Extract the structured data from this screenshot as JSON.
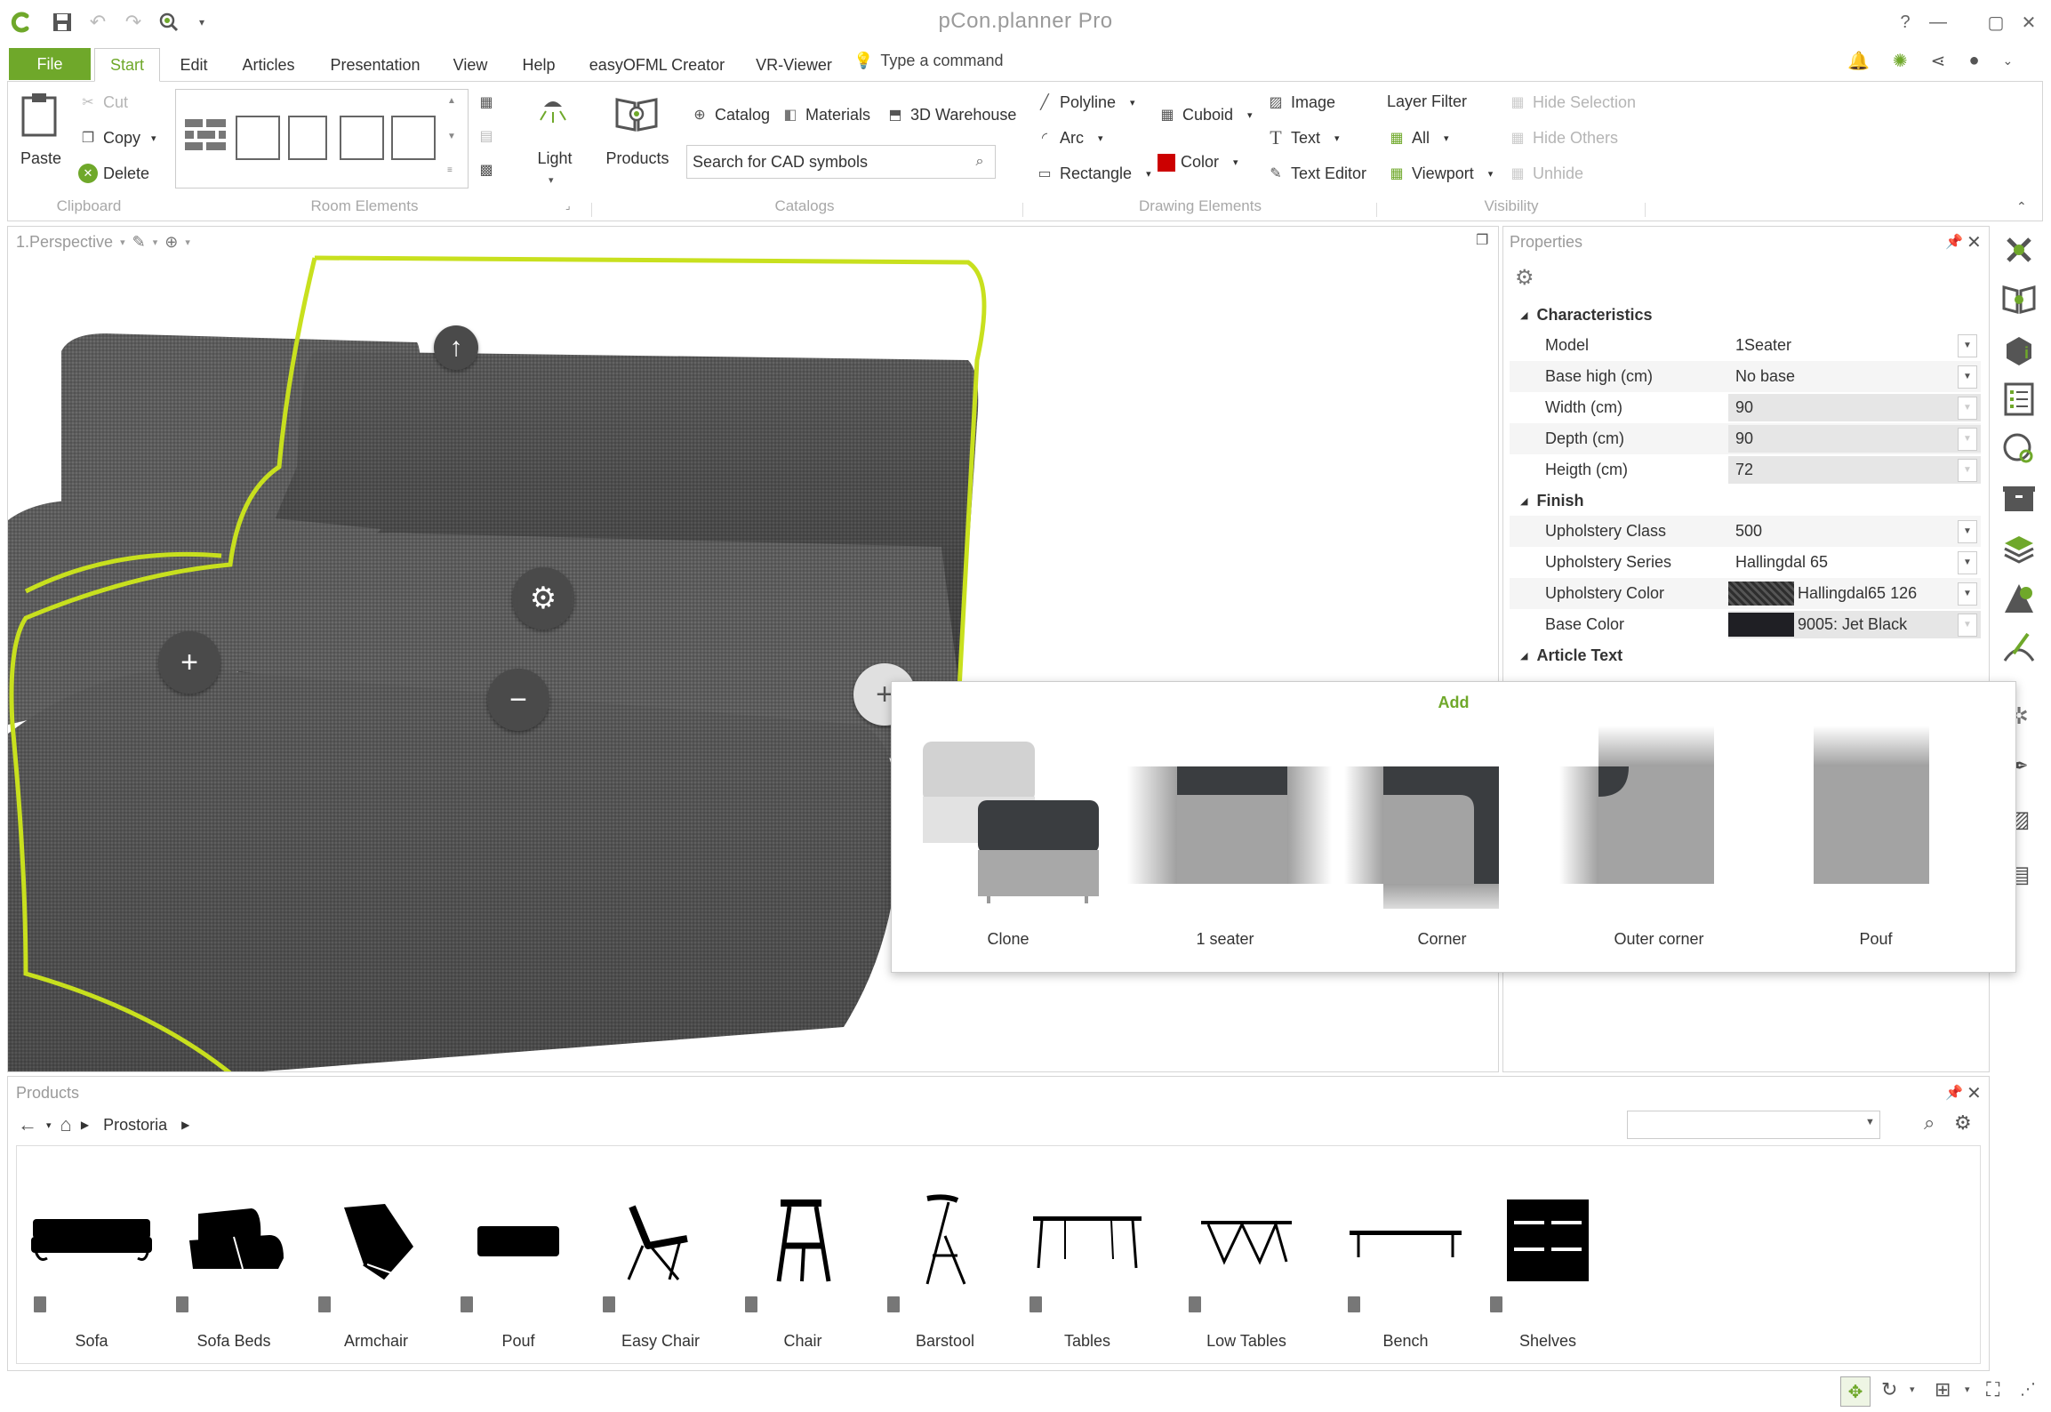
{
  "app": {
    "title": "pCon.planner Pro"
  },
  "menu": {
    "file": "File",
    "tabs": [
      "Start",
      "Edit",
      "Articles",
      "Presentation",
      "View",
      "Help",
      "easyOFML Creator",
      "VR-Viewer"
    ],
    "command_placeholder": "Type a command"
  },
  "ribbon": {
    "clipboard": {
      "paste": "Paste",
      "cut": "Cut",
      "copy": "Copy",
      "delete": "Delete",
      "group": "Clipboard"
    },
    "room": {
      "group": "Room Elements",
      "light": "Light"
    },
    "catalogs": {
      "products": "Products",
      "catalog": "Catalog",
      "materials": "Materials",
      "warehouse": "3D Warehouse",
      "search_placeholder": "Search for CAD symbols",
      "group": "Catalogs"
    },
    "drawing": {
      "polyline": "Polyline",
      "arc": "Arc",
      "rectangle": "Rectangle",
      "cuboid": "Cuboid",
      "color": "Color",
      "image": "Image",
      "text": "Text",
      "text_editor": "Text Editor",
      "group": "Drawing Elements",
      "color_hex": "#cc0000"
    },
    "visibility": {
      "layer_filter": "Layer Filter",
      "all": "All",
      "viewport": "Viewport",
      "hide_selection": "Hide Selection",
      "hide_others": "Hide Others",
      "unhide": "Unhide",
      "group": "Visibility"
    }
  },
  "viewport": {
    "title": "1.Perspective",
    "highlight_color": "#c8e01e"
  },
  "properties": {
    "title": "Properties",
    "sections": [
      {
        "name": "Characteristics",
        "rows": [
          {
            "name": "Model",
            "value": "1Seater",
            "editable": false,
            "dropdown": true
          },
          {
            "name": "Base high (cm)",
            "value": "No base",
            "editable": false,
            "dropdown": true
          },
          {
            "name": "Width (cm)",
            "value": "90",
            "editable": true,
            "dropdown": true
          },
          {
            "name": "Depth (cm)",
            "value": "90",
            "editable": true,
            "dropdown": true
          },
          {
            "name": "Heigth (cm)",
            "value": "72",
            "editable": true,
            "dropdown": true
          }
        ]
      },
      {
        "name": "Finish",
        "rows": [
          {
            "name": "Upholstery Class",
            "value": "500",
            "editable": false,
            "dropdown": true
          },
          {
            "name": "Upholstery Series",
            "value": "Hallingdal 65",
            "editable": false,
            "dropdown": true
          },
          {
            "name": "Upholstery Color",
            "value": "Hallingdal65 126",
            "editable": false,
            "dropdown": true,
            "swatch": "#3a3a3a"
          },
          {
            "name": "Base Color",
            "value": "9005: Jet Black",
            "editable": true,
            "dropdown": true,
            "swatch": "#1f1f24"
          }
        ]
      },
      {
        "name": "Article Text",
        "rows": []
      }
    ]
  },
  "add_popup": {
    "title": "Add",
    "items": [
      "Clone",
      "1 seater",
      "Corner",
      "Outer corner",
      "Pouf"
    ]
  },
  "products_panel": {
    "title": "Products",
    "breadcrumb": "Prostoria",
    "items": [
      "Sofa",
      "Sofa Beds",
      "Armchair",
      "Pouf",
      "Easy Chair",
      "Chair",
      "Barstool",
      "Tables",
      "Low Tables",
      "Bench",
      "Shelves"
    ]
  },
  "colors": {
    "accent": "#6fa82a"
  }
}
